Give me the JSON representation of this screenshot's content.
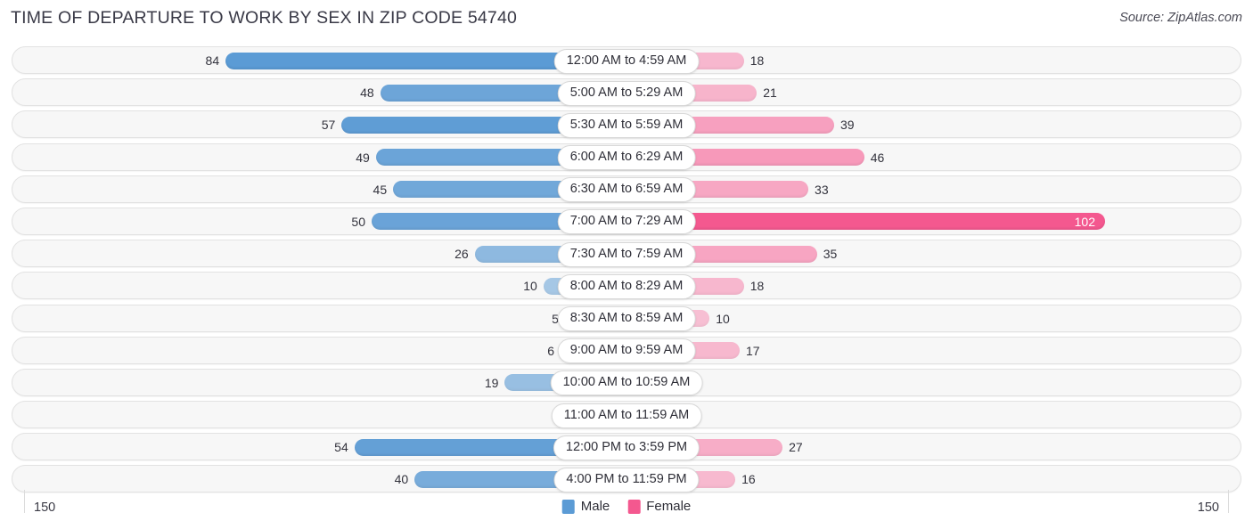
{
  "header": {
    "title": "TIME OF DEPARTURE TO WORK BY SEX IN ZIP CODE 54740",
    "source": "Source: ZipAtlas.com"
  },
  "footer": {
    "axis_left": "150",
    "axis_right": "150",
    "legend": [
      {
        "label": "Male",
        "color": "#5b9bd5"
      },
      {
        "label": "Female",
        "color": "#f4588f"
      }
    ]
  },
  "colors": {
    "male": "#5b9bd5",
    "male_light": "#a4c8ea",
    "female": "#f895b8",
    "female_strong": "#f4588f",
    "track": "#f7f7f7",
    "track_border": "#e2e2e2"
  },
  "chart_data": {
    "type": "bar",
    "title": "TIME OF DEPARTURE TO WORK BY SEX IN ZIP CODE 54740",
    "subtitle": "",
    "xlabel": "",
    "ylabel": "",
    "orientation": "horizontal-diverging",
    "xlim": [
      150,
      150
    ],
    "axis_max": 150,
    "grid": false,
    "legend_position": "bottom-center",
    "categories": [
      "12:00 AM to 4:59 AM",
      "5:00 AM to 5:29 AM",
      "5:30 AM to 5:59 AM",
      "6:00 AM to 6:29 AM",
      "6:30 AM to 6:59 AM",
      "7:00 AM to 7:29 AM",
      "7:30 AM to 7:59 AM",
      "8:00 AM to 8:29 AM",
      "8:30 AM to 8:59 AM",
      "9:00 AM to 9:59 AM",
      "10:00 AM to 10:59 AM",
      "11:00 AM to 11:59 AM",
      "12:00 PM to 3:59 PM",
      "4:00 PM to 11:59 PM"
    ],
    "series": [
      {
        "name": "Male",
        "side": "left",
        "values": [
          84,
          48,
          57,
          49,
          45,
          50,
          26,
          10,
          5,
          6,
          19,
          0,
          54,
          40
        ]
      },
      {
        "name": "Female",
        "side": "right",
        "values": [
          18,
          21,
          39,
          46,
          33,
          102,
          35,
          18,
          10,
          17,
          1,
          0,
          27,
          16
        ]
      }
    ]
  }
}
